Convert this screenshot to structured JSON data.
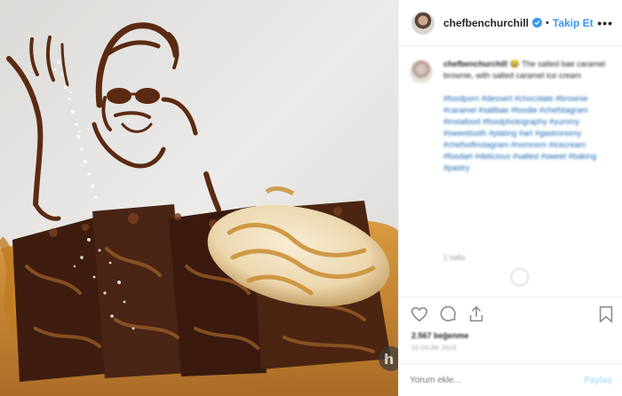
{
  "header": {
    "username": "chefbenchurchill",
    "follow_label": "Takip Et",
    "separator": "•",
    "more_label": "•••",
    "verified_color": "#3897f0"
  },
  "caption": {
    "username": "chefbenchurchill",
    "text": "😂 The salted bae caramel brownie, with salted caramel ice cream",
    "hashtags": "#foodporn #dessert #chocolate #brownie #caramel #saltbae #foodie #chefstagram #instafood #foodphotography #yummy #sweettooth #plating #art #gastronomy #chefsofinstagram #nomnom #icecream #foodart #delicious #salted #sweet #baking #pastry",
    "time_ago": "1 hafta",
    "tag_color": "#1d6ab4"
  },
  "actions": {
    "likes_text": "2.567 beğenme",
    "date_text": "10 OCAK 2019",
    "comment_placeholder": "Yorum ekle...",
    "post_label": "Paylaş"
  },
  "icons": [
    "heart-icon",
    "comment-icon",
    "share-icon",
    "bookmark-icon",
    "verified-icon",
    "more-options-icon"
  ]
}
